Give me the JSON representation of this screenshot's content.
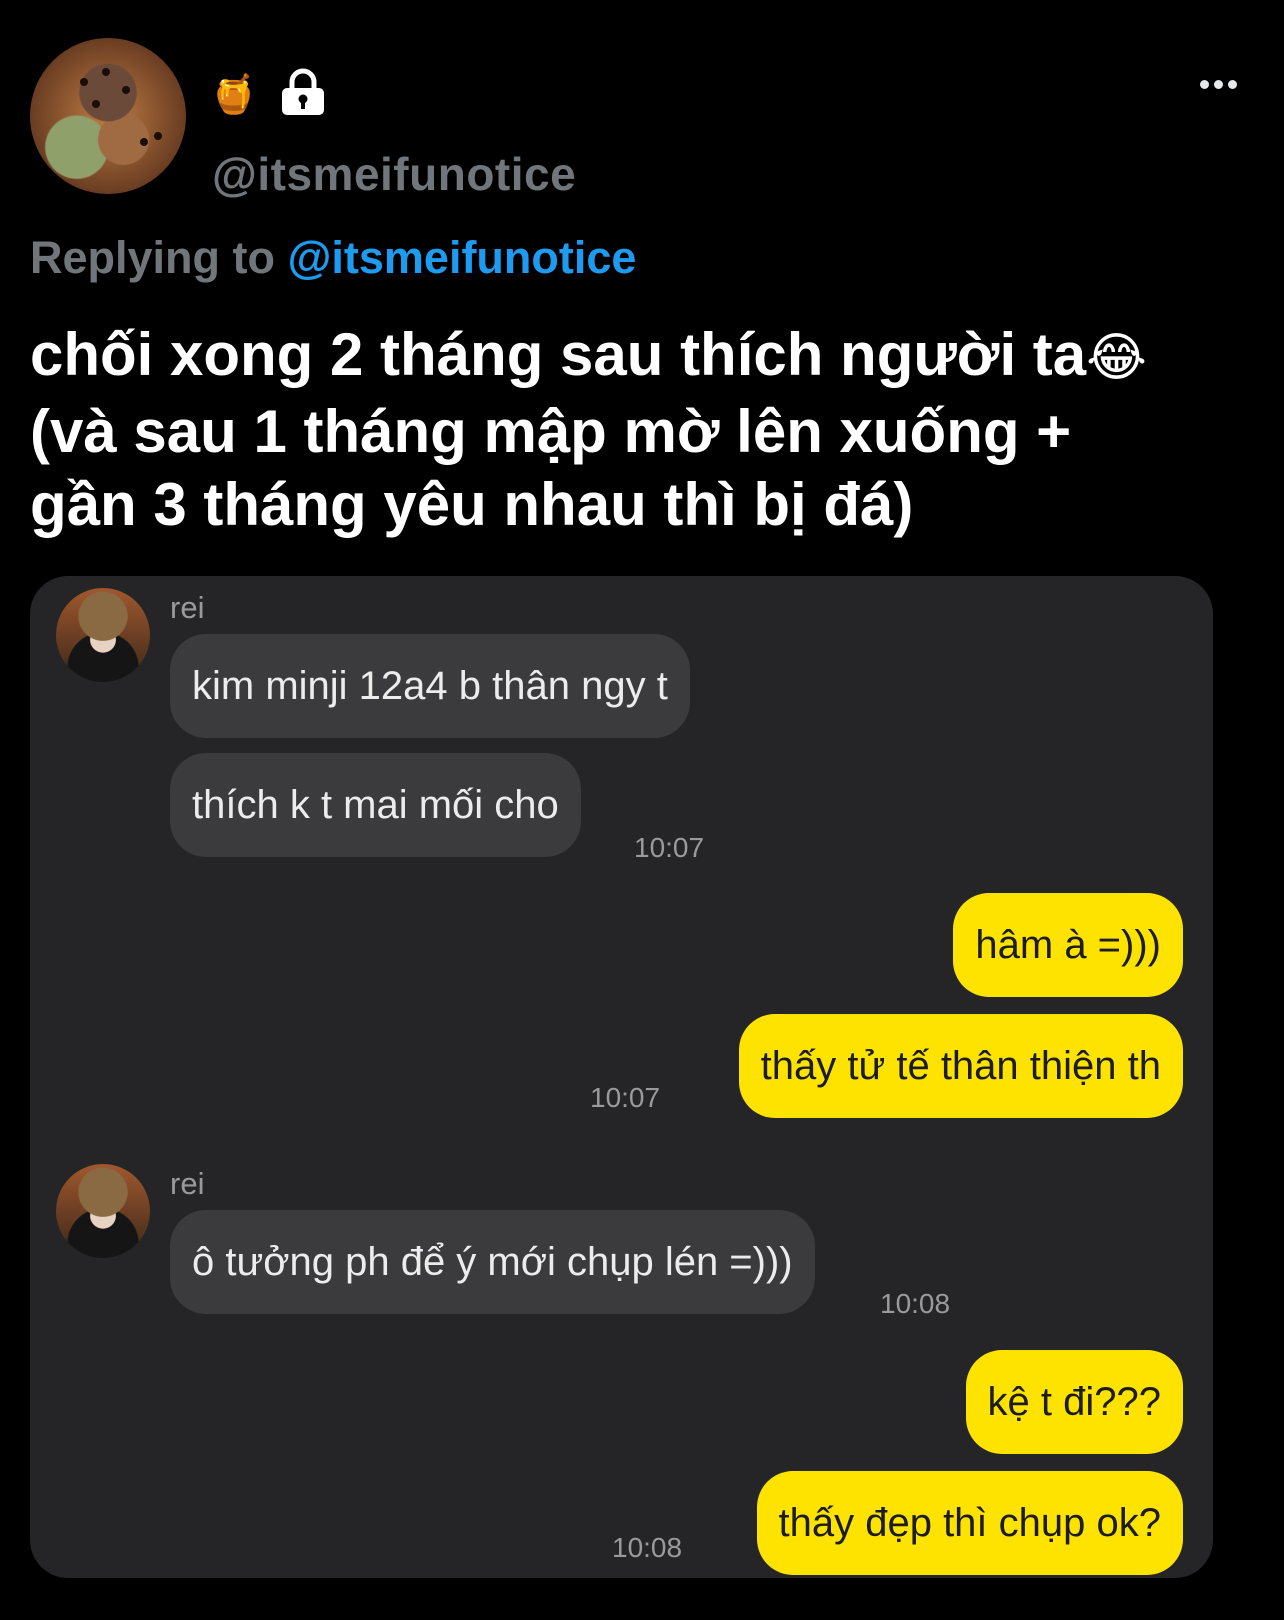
{
  "tweet": {
    "handle": "@itsmeifunotice",
    "emoji": "🍯",
    "replying_label": "Replying to",
    "replying_handle": "@itsmeifunotice",
    "text_lines": [
      "chối xong 2 tháng sau thích người ta",
      "(và sau 1 tháng mập mờ lên xuống +",
      "gần 3 tháng yêu nhau thì bị đá)"
    ],
    "text_emoji": "😂"
  },
  "chat": {
    "messages": [
      {
        "sender": "rei"
      },
      {
        "text": "kim minji 12a4 b thân ngy t"
      },
      {
        "text": "thích k t mai mối cho",
        "time": "10:07"
      },
      {
        "text": "hâm à =)))"
      },
      {
        "text": "thấy tử tế thân thiện th",
        "time": "10:07"
      },
      {
        "sender": "rei"
      },
      {
        "text": "ô tưởng ph để ý mới chụp lén =)))",
        "time": "10:08"
      },
      {
        "text": "kệ t đi???"
      },
      {
        "text": "thấy đẹp thì chụp ok?",
        "time": "10:08"
      }
    ]
  },
  "colors": {
    "background": "#000000",
    "secondary_text": "#71767b",
    "mention": "#1d9bf0",
    "chat_background": "#252527",
    "incoming_bubble": "#3b3b3d",
    "outgoing_bubble": "#ffe300"
  },
  "icons": [
    "honey-pot-icon",
    "lock-icon",
    "more-options-icon"
  ]
}
